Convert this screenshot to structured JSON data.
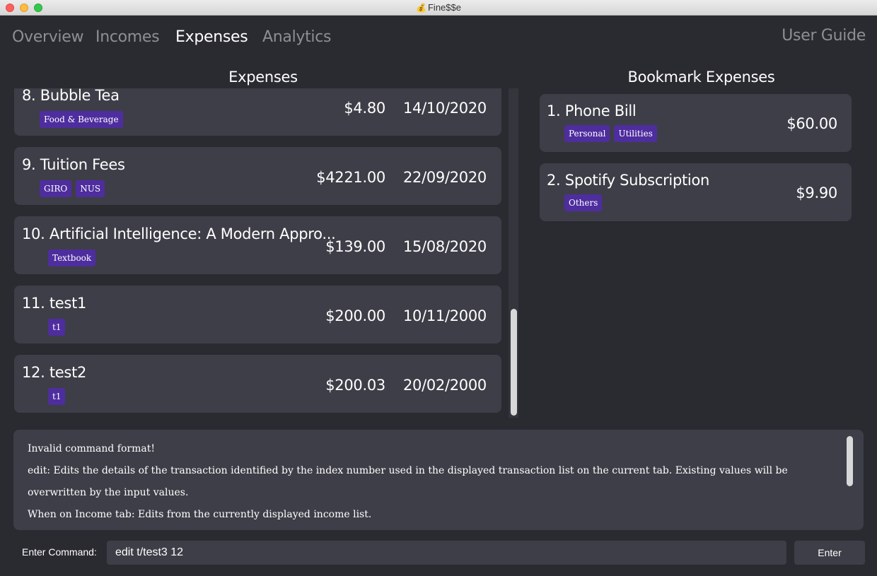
{
  "window": {
    "title": "Fine$$e",
    "icon": "money-bag-icon"
  },
  "nav": {
    "tabs": [
      {
        "label": "Overview"
      },
      {
        "label": "Incomes"
      },
      {
        "label": "Expenses"
      },
      {
        "label": "Analytics"
      }
    ],
    "active_tab": "Expenses",
    "user_guide": "User Guide"
  },
  "expenses": {
    "title": "Expenses",
    "items": [
      {
        "name": "8. Bubble Tea",
        "amount": "$4.80",
        "date": "14/10/2020",
        "tags": [
          "Food & Beverage"
        ]
      },
      {
        "name": "9. Tuition Fees",
        "amount": "$4221.00",
        "date": "22/09/2020",
        "tags": [
          "GIRO",
          "NUS"
        ]
      },
      {
        "name": "10. Artificial Intelligence: A Modern Appro...",
        "amount": "$139.00",
        "date": "15/08/2020",
        "tags": [
          "Textbook"
        ]
      },
      {
        "name": "11. test1",
        "amount": "$200.00",
        "date": "10/11/2000",
        "tags": [
          "t1"
        ]
      },
      {
        "name": "12. test2",
        "amount": "$200.03",
        "date": "20/02/2000",
        "tags": [
          "t1"
        ]
      }
    ]
  },
  "bookmarks": {
    "title": "Bookmark Expenses",
    "items": [
      {
        "name": "1. Phone Bill",
        "amount": "$60.00",
        "tags": [
          "Personal",
          "Utilities"
        ]
      },
      {
        "name": "2. Spotify Subscription",
        "amount": "$9.90",
        "tags": [
          "Others"
        ]
      }
    ]
  },
  "result": {
    "lines": [
      "Invalid command format!",
      "edit: Edits the details of the transaction identified by the index number used in the displayed transaction list on the current tab. Existing values will be overwritten by the input values.",
      "When on Income tab: Edits from the currently displayed income list."
    ]
  },
  "command": {
    "label": "Enter Command:",
    "value": "edit t/test3 12",
    "button": "Enter"
  },
  "colors": {
    "background": "#2a2a31",
    "card": "#3e3e48",
    "tag": "#4e2d9e"
  }
}
